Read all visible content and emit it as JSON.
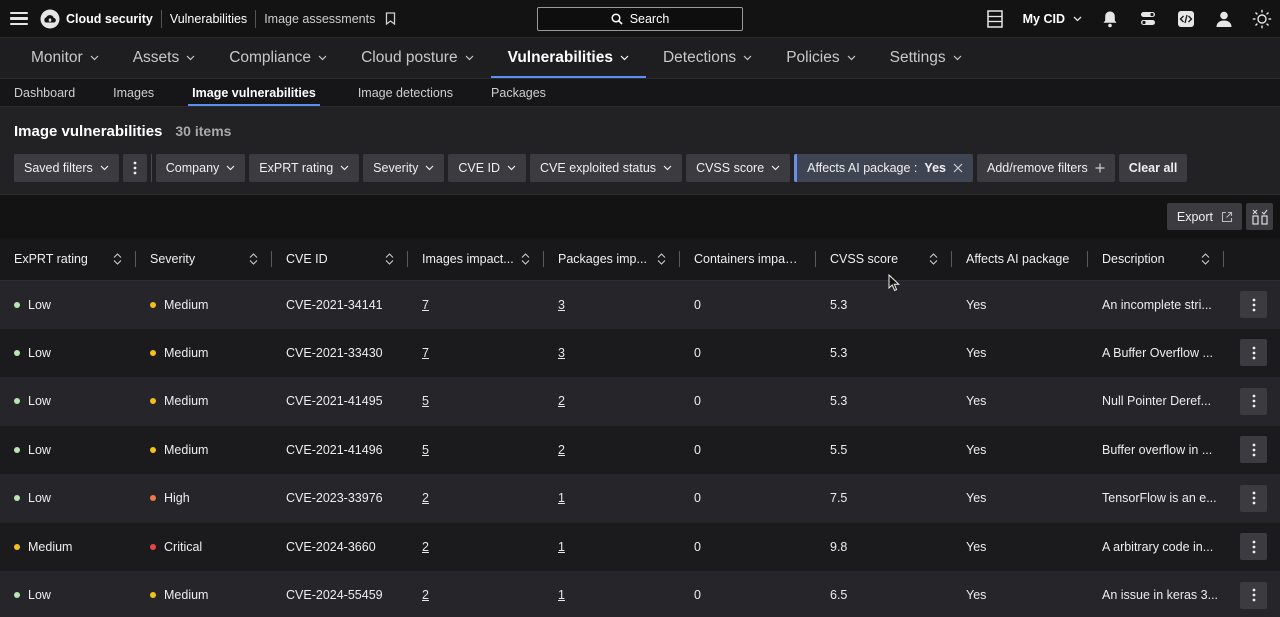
{
  "topbar": {
    "breadcrumb": [
      "Cloud security",
      "Vulnerabilities",
      "Image assessments"
    ],
    "search_label": "Search",
    "cid_label": "My CID"
  },
  "main_nav": [
    {
      "label": "Monitor",
      "active": false
    },
    {
      "label": "Assets",
      "active": false
    },
    {
      "label": "Compliance",
      "active": false
    },
    {
      "label": "Cloud posture",
      "active": false
    },
    {
      "label": "Vulnerabilities",
      "active": true
    },
    {
      "label": "Detections",
      "active": false
    },
    {
      "label": "Policies",
      "active": false
    },
    {
      "label": "Settings",
      "active": false
    }
  ],
  "sub_nav": [
    {
      "label": "Dashboard",
      "active": false
    },
    {
      "label": "Images",
      "active": false
    },
    {
      "label": "Image vulnerabilities",
      "active": true
    },
    {
      "label": "Image detections",
      "active": false
    },
    {
      "label": "Packages",
      "active": false
    }
  ],
  "page": {
    "title": "Image vulnerabilities",
    "count": "30 items"
  },
  "filters": {
    "saved_filters": "Saved filters",
    "items": [
      "Company",
      "ExPRT rating",
      "Severity",
      "CVE ID",
      "CVE exploited status",
      "CVSS score"
    ],
    "applied_label": "Affects AI package :",
    "applied_value": "Yes",
    "add_remove": "Add/remove filters",
    "clear_all": "Clear all"
  },
  "toolbar": {
    "export_label": "Export"
  },
  "table": {
    "columns": [
      "ExPRT rating",
      "Severity",
      "CVE ID",
      "Images impact...",
      "Packages imp...",
      "Containers impact...",
      "CVSS score",
      "Affects AI package",
      "Description"
    ],
    "rows": [
      {
        "exprt": "Low",
        "severity": "Medium",
        "cve": "CVE-2021-34141",
        "images": "7",
        "packages": "3",
        "containers": "0",
        "cvss": "5.3",
        "ai": "Yes",
        "desc": "An incomplete stri..."
      },
      {
        "exprt": "Low",
        "severity": "Medium",
        "cve": "CVE-2021-33430",
        "images": "7",
        "packages": "3",
        "containers": "0",
        "cvss": "5.3",
        "ai": "Yes",
        "desc": "A Buffer Overflow ..."
      },
      {
        "exprt": "Low",
        "severity": "Medium",
        "cve": "CVE-2021-41495",
        "images": "5",
        "packages": "2",
        "containers": "0",
        "cvss": "5.3",
        "ai": "Yes",
        "desc": "Null Pointer Deref..."
      },
      {
        "exprt": "Low",
        "severity": "Medium",
        "cve": "CVE-2021-41496",
        "images": "5",
        "packages": "2",
        "containers": "0",
        "cvss": "5.5",
        "ai": "Yes",
        "desc": "Buffer overflow in ..."
      },
      {
        "exprt": "Low",
        "severity": "High",
        "cve": "CVE-2023-33976",
        "images": "2",
        "packages": "1",
        "containers": "0",
        "cvss": "7.5",
        "ai": "Yes",
        "desc": "TensorFlow is an e..."
      },
      {
        "exprt": "Medium",
        "severity": "Critical",
        "cve": "CVE-2024-3660",
        "images": "2",
        "packages": "1",
        "containers": "0",
        "cvss": "9.8",
        "ai": "Yes",
        "desc": "A arbitrary code in..."
      },
      {
        "exprt": "Low",
        "severity": "Medium",
        "cve": "CVE-2024-55459",
        "images": "2",
        "packages": "1",
        "containers": "0",
        "cvss": "6.5",
        "ai": "Yes",
        "desc": "An issue in keras 3..."
      }
    ]
  },
  "colors": {
    "low": "#b8e6b0",
    "medium": "#f2c21b",
    "high": "#f0784a",
    "critical": "#e84545",
    "accent": "#5d8ff0"
  }
}
